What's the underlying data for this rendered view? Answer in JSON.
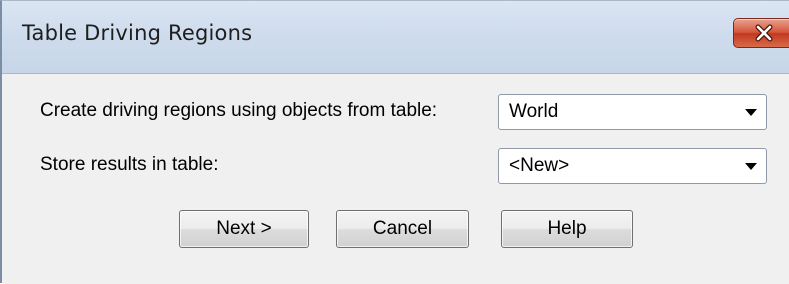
{
  "dialog": {
    "title": "Table Driving Regions",
    "close_icon": "close-icon"
  },
  "form": {
    "create_label": "Create driving regions using objects from table:",
    "create_value": "World",
    "store_label": "Store results in table:",
    "store_value": "<New>"
  },
  "buttons": {
    "next_label": "Next >",
    "cancel_label": "Cancel",
    "help_label": "Help"
  },
  "colors": {
    "title_bar": "#cfdced",
    "close_button": "#c23a20",
    "dialog_background": "#f0f0f0"
  }
}
